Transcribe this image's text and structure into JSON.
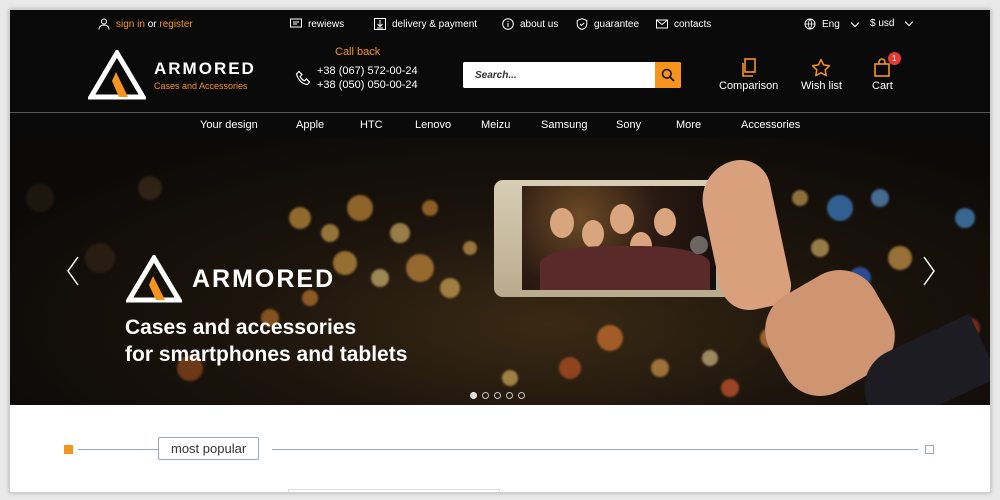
{
  "topbar": {
    "sign_in": "sign in",
    "or": "or",
    "register": "register",
    "links": [
      "rewiews",
      "delivery & payment",
      "about us",
      "guarantee",
      "contacts"
    ],
    "language": "Eng",
    "currency": "$ usd"
  },
  "header": {
    "logo_name": "ARMORED",
    "logo_subtitle": "Cases and Accessories",
    "callback_title": "Call back",
    "phone_1": "+38 (067) 572-00-24",
    "phone_2": "+38 (050) 050-00-24",
    "search_placeholder": "Search...",
    "comparison": "Comparison",
    "wishlist": "Wish list",
    "cart": "Cart",
    "cart_count": "1"
  },
  "nav": [
    "Your design",
    "Apple",
    "HTC",
    "Lenovo",
    "Meizu",
    "Samsung",
    "Sony",
    "More",
    "Accessories"
  ],
  "hero": {
    "brand": "ARMORED",
    "line1": "Cases and accessories",
    "line2": "for smartphones and tablets",
    "slides_total": 5,
    "active_slide": 1
  },
  "section": {
    "most_popular": "most popular"
  },
  "colors": {
    "accent": "#f7941d",
    "dark": "#0a0a0a",
    "badge": "#e53935"
  }
}
